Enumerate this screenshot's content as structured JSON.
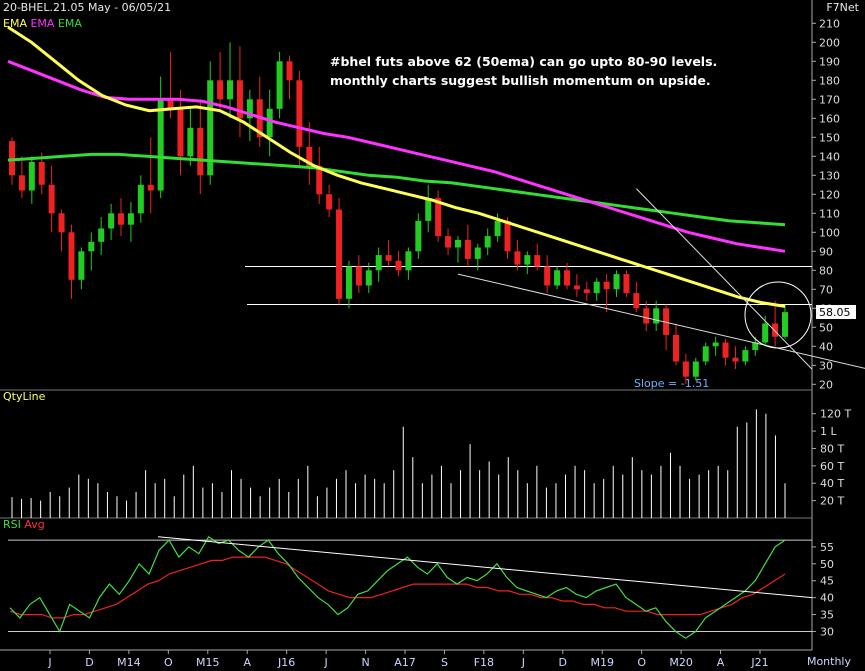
{
  "header": {
    "symbol_title": "20-BHEL.21.05 May - 06/05/21",
    "source": "F7Net",
    "period": "Monthly"
  },
  "legend": {
    "ema_items": [
      {
        "label": "EMA",
        "color": "#ffff55"
      },
      {
        "label": "EMA",
        "color": "#ff33ff"
      },
      {
        "label": "EMA",
        "color": "#33dd33"
      }
    ],
    "qty_title": "QtyLine",
    "rsi_items": [
      {
        "label": "RSI",
        "color": "#44dd44"
      },
      {
        "label": "Avg",
        "color": "#ff3333"
      }
    ]
  },
  "annotation": {
    "line1": "#bhel futs above 62 (50ema) can go upto 80-90 levels.",
    "line2": "monthly charts suggest bullish momentum on upside.",
    "slope_text": "Slope = -1.51",
    "last_price": "58.05"
  },
  "colors": {
    "up": "#22cc22",
    "down": "#ee2222",
    "ema_fast": "#ffff55",
    "ema_mid": "#ff33ff",
    "ema_slow": "#33dd33"
  },
  "chart_data": {
    "type": "candlestick",
    "x_ticks": [
      "J",
      "D",
      "M14",
      "O",
      "M15",
      "A",
      "J16",
      "J",
      "N",
      "A17",
      "S",
      "F18",
      "J",
      "D",
      "M19",
      "O",
      "M20",
      "A",
      "J21"
    ],
    "price_axis": {
      "ticks": [
        20,
        30,
        40,
        50,
        60,
        70,
        80,
        90,
        100,
        110,
        120,
        130,
        140,
        150,
        160,
        170,
        180,
        190,
        200,
        210
      ],
      "range": [
        17,
        217
      ]
    },
    "horizontal_levels": [
      82,
      62
    ],
    "ohlc": [
      [
        148,
        150,
        125,
        130
      ],
      [
        130,
        140,
        118,
        122
      ],
      [
        122,
        140,
        115,
        137
      ],
      [
        137,
        142,
        120,
        125
      ],
      [
        125,
        135,
        100,
        110
      ],
      [
        110,
        112,
        90,
        100
      ],
      [
        100,
        104,
        65,
        75
      ],
      [
        75,
        92,
        70,
        90
      ],
      [
        90,
        100,
        80,
        95
      ],
      [
        95,
        108,
        88,
        102
      ],
      [
        102,
        115,
        96,
        110
      ],
      [
        110,
        118,
        98,
        104
      ],
      [
        104,
        116,
        95,
        110
      ],
      [
        110,
        130,
        105,
        125
      ],
      [
        125,
        150,
        110,
        122
      ],
      [
        122,
        182,
        118,
        170
      ],
      [
        170,
        195,
        160,
        165
      ],
      [
        165,
        175,
        130,
        140
      ],
      [
        140,
        165,
        135,
        155
      ],
      [
        155,
        170,
        120,
        130
      ],
      [
        130,
        190,
        125,
        180
      ],
      [
        180,
        195,
        165,
        170
      ],
      [
        170,
        200,
        160,
        180
      ],
      [
        180,
        198,
        150,
        160
      ],
      [
        160,
        175,
        148,
        170
      ],
      [
        170,
        182,
        145,
        150
      ],
      [
        150,
        175,
        140,
        165
      ],
      [
        165,
        195,
        160,
        190
      ],
      [
        190,
        193,
        170,
        180
      ],
      [
        180,
        185,
        135,
        145
      ],
      [
        145,
        158,
        125,
        135
      ],
      [
        135,
        145,
        115,
        120
      ],
      [
        120,
        125,
        108,
        112
      ],
      [
        112,
        118,
        62,
        65
      ],
      [
        65,
        85,
        60,
        82
      ],
      [
        82,
        88,
        68,
        72
      ],
      [
        72,
        84,
        68,
        80
      ],
      [
        80,
        92,
        74,
        88
      ],
      [
        88,
        96,
        82,
        85
      ],
      [
        85,
        90,
        77,
        80
      ],
      [
        80,
        92,
        75,
        90
      ],
      [
        90,
        110,
        86,
        106
      ],
      [
        106,
        125,
        100,
        118
      ],
      [
        118,
        122,
        95,
        98
      ],
      [
        98,
        102,
        88,
        92
      ],
      [
        92,
        98,
        84,
        96
      ],
      [
        96,
        104,
        82,
        86
      ],
      [
        86,
        94,
        80,
        92
      ],
      [
        92,
        102,
        88,
        98
      ],
      [
        98,
        110,
        95,
        106
      ],
      [
        106,
        108,
        86,
        90
      ],
      [
        90,
        96,
        80,
        83
      ],
      [
        83,
        90,
        78,
        88
      ],
      [
        88,
        94,
        80,
        82
      ],
      [
        82,
        88,
        68,
        72
      ],
      [
        72,
        82,
        70,
        80
      ],
      [
        80,
        84,
        70,
        72
      ],
      [
        72,
        78,
        66,
        70
      ],
      [
        70,
        74,
        64,
        68
      ],
      [
        68,
        76,
        64,
        74
      ],
      [
        74,
        78,
        58,
        70
      ],
      [
        70,
        80,
        66,
        78
      ],
      [
        78,
        80,
        66,
        68
      ],
      [
        68,
        74,
        58,
        60
      ],
      [
        60,
        64,
        48,
        52
      ],
      [
        52,
        64,
        48,
        60
      ],
      [
        60,
        62,
        38,
        46
      ],
      [
        46,
        52,
        30,
        32
      ],
      [
        32,
        36,
        20,
        24
      ],
      [
        24,
        34,
        22,
        32
      ],
      [
        32,
        42,
        30,
        40
      ],
      [
        40,
        45,
        35,
        42
      ],
      [
        42,
        44,
        30,
        34
      ],
      [
        34,
        40,
        28,
        32
      ],
      [
        32,
        40,
        30,
        38
      ],
      [
        38,
        45,
        35,
        42
      ],
      [
        42,
        56,
        40,
        52
      ],
      [
        52,
        64,
        40,
        45
      ],
      [
        45,
        62,
        44,
        58
      ]
    ],
    "ema_fast": [
      208,
      200,
      190,
      180,
      172,
      167,
      164,
      165,
      166,
      164,
      158,
      150,
      142,
      135,
      130,
      126,
      123,
      120,
      117,
      113,
      110,
      106,
      102,
      98,
      94,
      90,
      86,
      82,
      78,
      74,
      70,
      66,
      63,
      61
    ],
    "ema_mid": [
      190,
      185,
      180,
      175,
      171,
      170,
      170,
      170,
      169,
      166,
      162,
      158,
      155,
      152,
      150,
      147,
      144,
      141,
      138,
      135,
      132,
      128,
      124,
      120,
      116,
      112,
      108,
      104,
      100,
      97,
      94,
      92,
      90
    ],
    "ema_slow": [
      138,
      139,
      140,
      141,
      141,
      140,
      139,
      138,
      137,
      136,
      135,
      134,
      132,
      130,
      129,
      127,
      126,
      124,
      122,
      120,
      118,
      116,
      114,
      112,
      110,
      108,
      106,
      105,
      104
    ],
    "trend_channel": {
      "upper": [
        [
          63,
          123
        ],
        [
          115,
          28
        ]
      ],
      "lower": [
        [
          45,
          78
        ],
        [
          93,
          20
        ]
      ]
    },
    "qty_axis": {
      "ticks": [
        "120 T",
        "1 L",
        "80 T",
        "60 T",
        "40 T",
        "20 T"
      ]
    },
    "qty": [
      24,
      22,
      23,
      20,
      30,
      25,
      35,
      50,
      45,
      40,
      30,
      25,
      20,
      30,
      55,
      40,
      45,
      25,
      50,
      60,
      35,
      40,
      30,
      55,
      45,
      35,
      25,
      35,
      45,
      30,
      45,
      60,
      25,
      35,
      45,
      55,
      40,
      50,
      45,
      40,
      55,
      105,
      70,
      40,
      50,
      60,
      40,
      55,
      85,
      55,
      65,
      50,
      70,
      55,
      40,
      60,
      35,
      40,
      50,
      60,
      55,
      40,
      45,
      60,
      50,
      70,
      55,
      50,
      60,
      75,
      60,
      45,
      50,
      55,
      60,
      55,
      105,
      110,
      125,
      120,
      95,
      40
    ],
    "rsi_axis": {
      "ticks": [
        30,
        35,
        40,
        45,
        50,
        55
      ],
      "range": [
        26,
        60
      ]
    },
    "rsi_levels": [
      30,
      57
    ],
    "rsi": [
      37,
      34,
      38,
      40,
      35,
      30,
      38,
      36,
      34,
      40,
      44,
      41,
      45,
      50,
      47,
      54,
      57,
      52,
      55,
      53,
      58,
      56,
      57,
      54,
      52,
      55,
      57,
      53,
      50,
      46,
      43,
      40,
      38,
      35,
      37,
      41,
      42,
      45,
      48,
      50,
      52,
      49,
      47,
      50,
      46,
      44,
      46,
      45,
      47,
      50,
      46,
      43,
      42,
      41,
      40,
      42,
      43,
      41,
      40,
      42,
      43,
      44,
      40,
      38,
      36,
      37,
      33,
      30,
      28,
      30,
      34,
      36,
      38,
      40,
      42,
      45,
      50,
      55,
      57
    ],
    "rsi_avg": [
      36,
      35,
      35,
      35,
      34,
      34,
      35,
      35,
      36,
      37,
      38,
      40,
      42,
      44,
      45,
      47,
      48,
      49,
      50,
      51,
      51,
      52,
      52,
      52,
      52,
      51,
      50,
      48,
      46,
      44,
      42,
      41,
      40,
      40,
      40,
      41,
      42,
      43,
      44,
      44,
      44,
      44,
      44,
      44,
      43,
      43,
      42,
      42,
      41,
      41,
      40,
      40,
      39,
      39,
      38,
      38,
      37,
      37,
      36,
      36,
      36,
      35,
      35,
      35,
      35,
      35,
      36,
      37,
      38,
      40,
      41,
      43,
      45,
      47
    ],
    "rsi_trendline": [
      [
        0,
        58
      ],
      [
        100,
        40
      ]
    ]
  }
}
